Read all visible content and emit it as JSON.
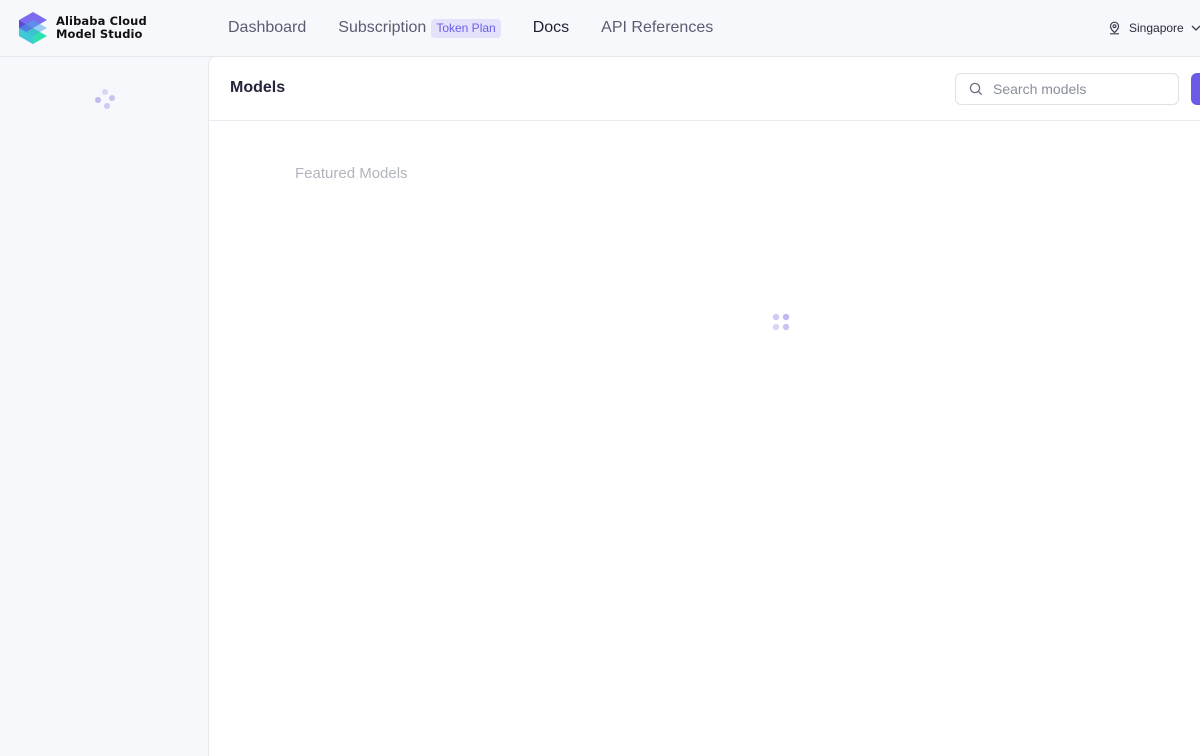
{
  "brand": {
    "line1": "Alibaba Cloud",
    "line2": "Model Studio",
    "colors": {
      "top": "#6a5be6",
      "mid": "#3fc9d6",
      "bottom": "#2fe0b0"
    }
  },
  "nav": {
    "items": [
      {
        "label": "Dashboard",
        "active": false
      },
      {
        "label": "Subscription",
        "badge": "Token Plan",
        "active": false
      },
      {
        "label": "Docs",
        "active": true
      },
      {
        "label": "API References",
        "active": false
      }
    ]
  },
  "region": {
    "label": "Singapore",
    "icon": "location-pin-icon"
  },
  "main": {
    "title": "Models",
    "search": {
      "placeholder": "Search models",
      "value": ""
    },
    "section_title": "Featured Models",
    "loading": true
  },
  "colors": {
    "accent": "#6b5ce7",
    "spinner": "#c8c3f3"
  }
}
